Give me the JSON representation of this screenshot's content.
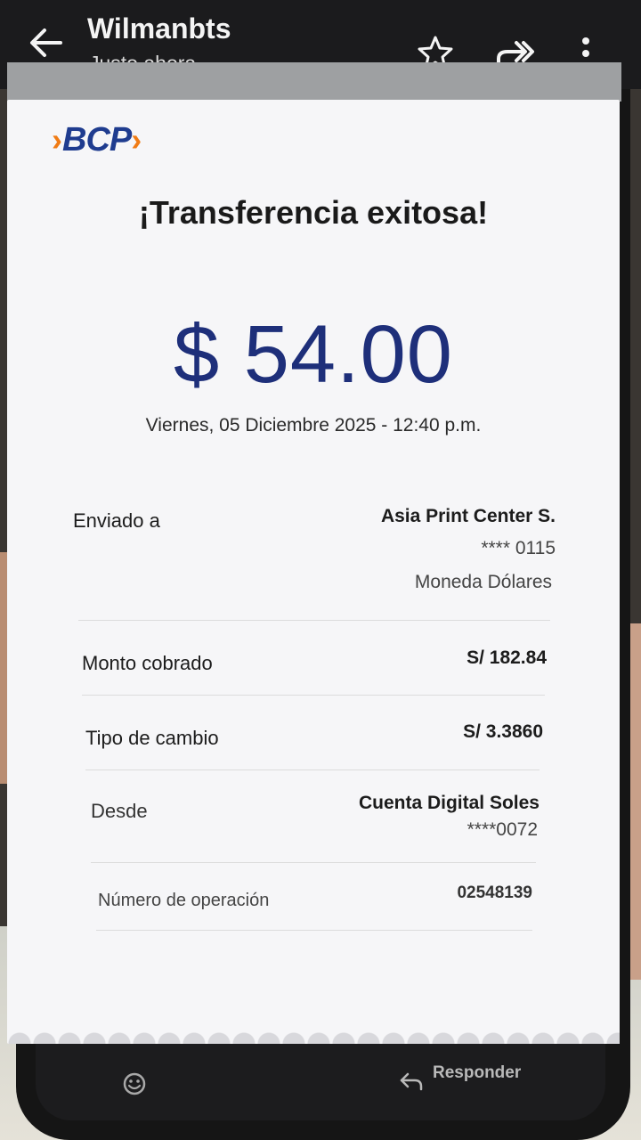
{
  "header": {
    "sender": "Wilmanbts",
    "subtitle": "Justo ahora"
  },
  "receipt": {
    "brand": "BCP",
    "title": "¡Transferencia exitosa!",
    "amount": "$ 54.00",
    "datetime": "Viernes, 05 Diciembre 2025 - 12:40 p.m.",
    "sent_to": {
      "label": "Enviado a",
      "name": "Asia Print Center S.",
      "account": "**** 0115",
      "currency": "Moneda Dólares"
    },
    "charged": {
      "label": "Monto cobrado",
      "value": "S/ 182.84"
    },
    "exchange": {
      "label": "Tipo de cambio",
      "value": "S/ 3.3860"
    },
    "from": {
      "label": "Desde",
      "account_name": "Cuenta Digital Soles",
      "account": "****0072"
    },
    "operation": {
      "label": "Número de operación",
      "value": "02548139"
    }
  },
  "footer": {
    "reply_label": "Responder"
  },
  "colors": {
    "brand_blue": "#1e2f7a",
    "brand_orange": "#f07b14"
  }
}
